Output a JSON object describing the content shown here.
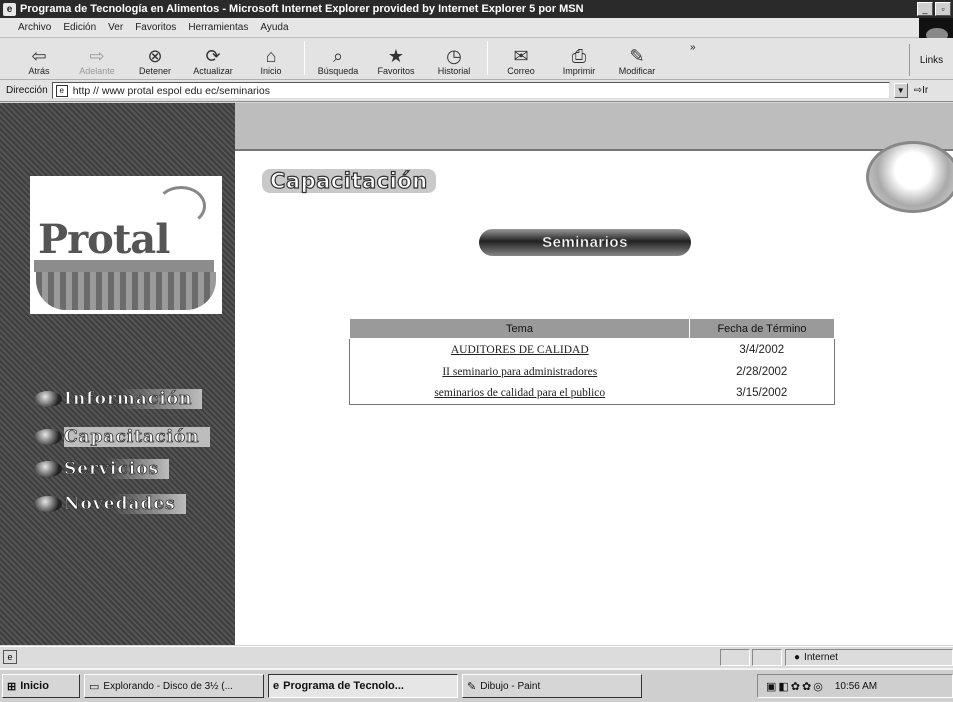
{
  "window": {
    "title": "Programa de Tecnología en Alimentos - Microsoft Internet Explorer provided by Internet Explorer 5 por MSN",
    "icon": "ie-page-icon"
  },
  "menu": [
    "Archivo",
    "Edición",
    "Ver",
    "Favoritos",
    "Herramientas",
    "Ayuda"
  ],
  "toolbar": {
    "buttons": [
      {
        "label": "Atrás",
        "icon": "back-arrow",
        "glyph": "⇦"
      },
      {
        "label": "Adelante",
        "icon": "forward-arrow",
        "glyph": "⇨"
      },
      {
        "label": "Detener",
        "icon": "stop",
        "glyph": "⊗"
      },
      {
        "label": "Actualizar",
        "icon": "refresh",
        "glyph": "⟳"
      },
      {
        "label": "Inicio",
        "icon": "home",
        "glyph": "⌂"
      },
      {
        "label": "Búsqueda",
        "icon": "search",
        "glyph": "⌕"
      },
      {
        "label": "Favoritos",
        "icon": "favorites",
        "glyph": "★"
      },
      {
        "label": "Historial",
        "icon": "history",
        "glyph": "◷"
      },
      {
        "label": "Correo",
        "icon": "mail",
        "glyph": "✉"
      },
      {
        "label": "Imprimir",
        "icon": "print",
        "glyph": "⎙"
      },
      {
        "label": "Modificar",
        "icon": "edit",
        "glyph": "✎"
      }
    ],
    "links_label": "Links",
    "chevron": "»"
  },
  "address": {
    "label": "Dirección",
    "url": "http // www protal espol edu ec/seminarios",
    "go_label": "Ir"
  },
  "page": {
    "logo_text": "Protal",
    "section_title": "Capacitación",
    "pill_label": "Seminarios",
    "nav": [
      {
        "label": "Información"
      },
      {
        "label": "Capacitación"
      },
      {
        "label": "Servicios"
      },
      {
        "label": "Novedades"
      }
    ],
    "table": {
      "headers": [
        "Tema",
        "Fecha de Término"
      ],
      "rows": [
        {
          "topic": "AUDITORES DE CALIDAD",
          "date": "3/4/2002"
        },
        {
          "topic": "II seminario para administradores",
          "date": "2/28/2002"
        },
        {
          "topic": "seminarios de calidad para el publico",
          "date": "3/15/2002"
        }
      ]
    }
  },
  "status": {
    "zone": "Internet"
  },
  "taskbar": {
    "start": "Inicio",
    "tasks": [
      {
        "label": "Explorando - Disco de 3½ (..."
      },
      {
        "label": "Programa de Tecnolo..."
      },
      {
        "label": "Dibujo - Paint"
      }
    ],
    "clock": "10:56 AM"
  }
}
